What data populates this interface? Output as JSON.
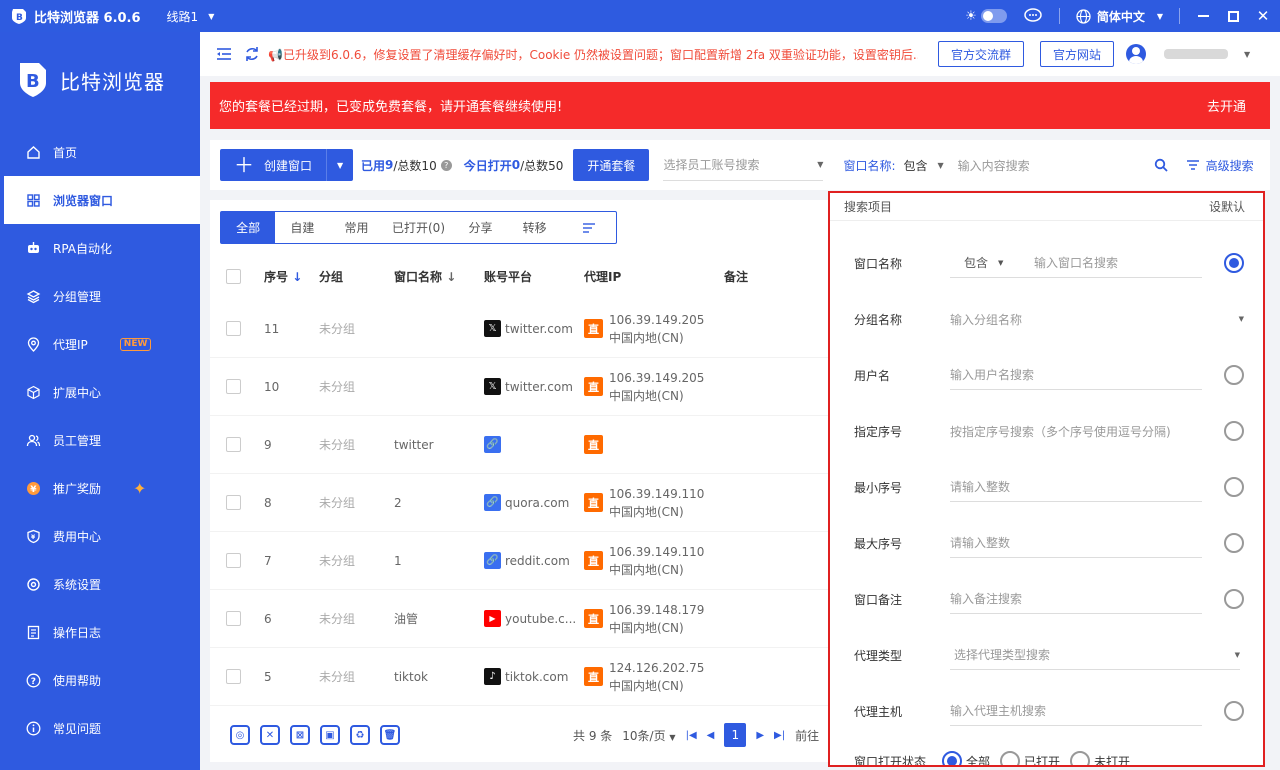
{
  "titlebar": {
    "app_title": "比特浏览器 6.0.6",
    "line": "线路1",
    "language": "简体中文"
  },
  "sidebar": {
    "brand": "比特浏览器",
    "items": [
      {
        "label": "首页",
        "icon": "home-icon"
      },
      {
        "label": "浏览器窗口",
        "icon": "grid-icon",
        "active": true
      },
      {
        "label": "RPA自动化",
        "icon": "rpa-icon"
      },
      {
        "label": "分组管理",
        "icon": "layers-icon"
      },
      {
        "label": "代理IP",
        "icon": "location-icon",
        "badge": "NEW"
      },
      {
        "label": "扩展中心",
        "icon": "cube-icon"
      },
      {
        "label": "员工管理",
        "icon": "users-icon"
      },
      {
        "label": "推广奖励",
        "icon": "reward-icon"
      },
      {
        "label": "费用中心",
        "icon": "shield-icon"
      },
      {
        "label": "系统设置",
        "icon": "gear-icon"
      },
      {
        "label": "操作日志",
        "icon": "log-icon"
      },
      {
        "label": "使用帮助",
        "icon": "help-icon"
      },
      {
        "label": "常见问题",
        "icon": "info-icon"
      }
    ]
  },
  "topbar": {
    "notice": "📢已升级到6.0.6，修复设置了清理缓存偏好时，Cookie 仍然被设置问题；窗口配置新增 2fa 双重验证功能，设置密钥后...",
    "btn_group": "官方交流群",
    "btn_site": "官方网站"
  },
  "alert": {
    "text": "您的套餐已经过期，已变成免费套餐，请开通套餐继续使用!",
    "action": "去开通"
  },
  "toolbar": {
    "create": "创建窗口",
    "used_label": "已用",
    "used": "9",
    "used_total": "/总数10",
    "today_label": "今日打开",
    "today": "0",
    "today_total": "/总数50",
    "open_plan": "开通套餐",
    "emp_placeholder": "选择员工账号搜索",
    "win_name_label": "窗口名称:",
    "contain": "包含",
    "search_placeholder": "输入内容搜索",
    "advanced": "高级搜索"
  },
  "tabs": [
    "全部",
    "自建",
    "常用",
    "已打开(0)",
    "分享",
    "转移"
  ],
  "table": {
    "headers": {
      "no": "序号",
      "group": "分组",
      "name": "窗口名称",
      "platform": "账号平台",
      "proxy": "代理IP",
      "note": "备注"
    },
    "rows": [
      {
        "no": "11",
        "group": "未分组",
        "name": "",
        "platform": "twitter.com",
        "pico": "x-logo-icon",
        "ip": "106.39.149.205",
        "region": "中国内地(CN)"
      },
      {
        "no": "10",
        "group": "未分组",
        "name": "",
        "platform": "twitter.com",
        "pico": "x-logo-icon",
        "ip": "106.39.149.205",
        "region": "中国内地(CN)"
      },
      {
        "no": "9",
        "group": "未分组",
        "name": "twitter",
        "platform": "",
        "pico": "link-icon",
        "ip": "",
        "region": ""
      },
      {
        "no": "8",
        "group": "未分组",
        "name": "2",
        "platform": "quora.com",
        "pico": "link-icon",
        "ip": "106.39.149.110",
        "region": "中国内地(CN)"
      },
      {
        "no": "7",
        "group": "未分组",
        "name": "1",
        "platform": "reddit.com",
        "pico": "link-icon",
        "ip": "106.39.149.110",
        "region": "中国内地(CN)"
      },
      {
        "no": "6",
        "group": "未分组",
        "name": "油管",
        "platform": "youtube.c...",
        "pico": "youtube-icon",
        "ip": "106.39.148.179",
        "region": "中国内地(CN)"
      },
      {
        "no": "5",
        "group": "未分组",
        "name": "tiktok",
        "platform": "tiktok.com",
        "pico": "tiktok-icon",
        "ip": "124.126.202.75",
        "region": "中国内地(CN)"
      }
    ],
    "proxy_tag": "直"
  },
  "pager": {
    "total": "共 9 条",
    "per_page": "10条/页",
    "current": "1",
    "goto": "前往"
  },
  "panel": {
    "title": "搜索项目",
    "set_default": "设默认",
    "rows": [
      {
        "label": "窗口名称",
        "contain": "包含",
        "placeholder": "输入窗口名搜索",
        "selected": true
      },
      {
        "label": "分组名称",
        "placeholder": "输入分组名称",
        "dropdown": true
      },
      {
        "label": "用户名",
        "placeholder": "输入用户名搜索"
      },
      {
        "label": "指定序号",
        "placeholder": "按指定序号搜索（多个序号使用逗号分隔)"
      },
      {
        "label": "最小序号",
        "placeholder": "请输入整数"
      },
      {
        "label": "最大序号",
        "placeholder": "请输入整数"
      },
      {
        "label": "窗口备注",
        "placeholder": "输入备注搜索"
      },
      {
        "label": "代理类型",
        "placeholder": "选择代理类型搜索",
        "dropdown": true
      },
      {
        "label": "代理主机",
        "placeholder": "输入代理主机搜索"
      }
    ],
    "open_state": {
      "label": "窗口打开状态",
      "options": [
        "全部",
        "已打开",
        "未打开"
      ],
      "selected": "全部"
    }
  },
  "colors": {
    "primary": "#2f5ae0",
    "alert": "#f52a2a",
    "proxy_tag": "#ff6a00",
    "highlight_border": "#e02020"
  }
}
